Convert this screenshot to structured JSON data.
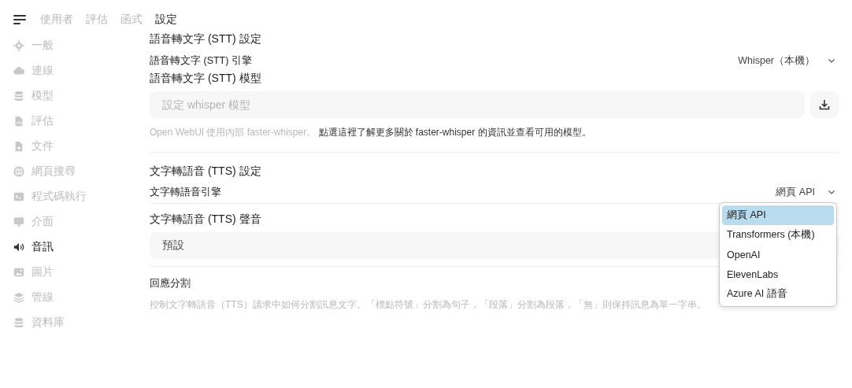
{
  "top_tabs": [
    {
      "label": "使用者",
      "selected": false
    },
    {
      "label": "評估",
      "selected": false
    },
    {
      "label": "函式",
      "selected": false
    },
    {
      "label": "設定",
      "selected": true
    }
  ],
  "sidebar": {
    "items": [
      {
        "label": "一般",
        "selected": false
      },
      {
        "label": "連線",
        "selected": false
      },
      {
        "label": "模型",
        "selected": false
      },
      {
        "label": "評估",
        "selected": false
      },
      {
        "label": "文件",
        "selected": false
      },
      {
        "label": "網頁搜尋",
        "selected": false
      },
      {
        "label": "程式碼執行",
        "selected": false
      },
      {
        "label": "介面",
        "selected": false
      },
      {
        "label": "音訊",
        "selected": true
      },
      {
        "label": "圖片",
        "selected": false
      },
      {
        "label": "管線",
        "selected": false
      },
      {
        "label": "資料庫",
        "selected": false
      }
    ]
  },
  "stt": {
    "heading": "語音轉文字 (STT) 設定",
    "engine_label": "語音轉文字 (STT) 引擎",
    "engine_value": "Whisper（本機）",
    "model_heading": "語音轉文字 (STT) 模型",
    "model_placeholder": "設定 whisper 模型",
    "note": "Open WebUI 使用內部 faster-whisper。",
    "link": "點選這裡了解更多關於 faster-whisper 的資訊並查看可用的模型。"
  },
  "tts": {
    "heading": "文字轉語音 (TTS) 設定",
    "engine_label": "文字轉語音引擎",
    "engine_value": "網頁 API",
    "voice_heading": "文字轉語音 (TTS) 聲音",
    "voice_value": "預設",
    "split_label": "回應分割",
    "split_note": "控制文字轉語音（TTS）請求中如何分割訊息文字。「標點符號」分割為句子，「段落」分割為段落，「無」則保持訊息為單一字串。"
  },
  "engine_menu": {
    "expanded": true,
    "options": [
      {
        "label": "網頁 API",
        "selected": true
      },
      {
        "label": "Transformers (本機)",
        "selected": false
      },
      {
        "label": "OpenAI",
        "selected": false
      },
      {
        "label": "ElevenLabs",
        "selected": false
      },
      {
        "label": "Azure AI 語音",
        "selected": false
      }
    ]
  }
}
